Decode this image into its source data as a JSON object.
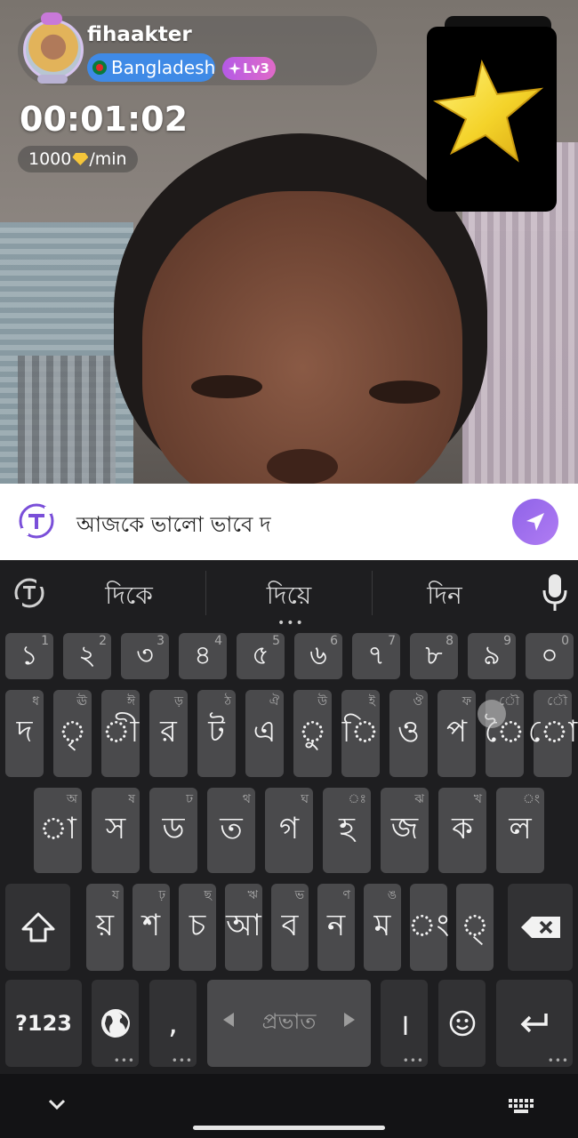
{
  "call": {
    "username": "fihaakter",
    "country": "Bangladesh",
    "level": "Lv3",
    "timer": "00:01:02",
    "rate_amount": "1000",
    "rate_unit": "/min",
    "gem_icon": "gem-icon"
  },
  "message": {
    "text": "আজকে ভালো ভাবে দ",
    "send_icon": "send-icon"
  },
  "keyboard": {
    "suggestions": [
      "দিকে",
      "দিয়ে",
      "দিন"
    ],
    "number_row": [
      "১",
      "২",
      "৩",
      "৪",
      "৫",
      "৬",
      "৭",
      "৮",
      "৯",
      "০"
    ],
    "number_hints": [
      "1",
      "2",
      "3",
      "4",
      "5",
      "6",
      "7",
      "8",
      "9",
      "0"
    ],
    "row1": [
      "দ",
      "ৃ",
      "ী",
      "র",
      "ট",
      "এ",
      "ু",
      "ি",
      "ও",
      "প",
      "ৈ",
      "ো"
    ],
    "row1_hints": [
      "ধ",
      "ঊ",
      "ঈ",
      "ড়",
      "ঠ",
      "ঐ",
      "উ",
      "ই",
      "ঔ",
      "ফ",
      "ৌ",
      "ৌ"
    ],
    "row2": [
      "া",
      "স",
      "ড",
      "ত",
      "গ",
      "হ",
      "জ",
      "ক",
      "ল"
    ],
    "row2_hints": [
      "অ",
      "ষ",
      "ঢ",
      "থ",
      "ঘ",
      "ঃ",
      "ঝ",
      "খ",
      "ং"
    ],
    "row3": [
      "য়",
      "শ",
      "চ",
      "আ",
      "ব",
      "ন",
      "ম",
      "ং",
      "্"
    ],
    "row3_hints": [
      "য",
      "ঢ়",
      "ছ",
      "ঋ",
      "ভ",
      "ণ",
      "ঙ",
      "",
      ""
    ],
    "mode_key": "?123",
    "comma_key": ",",
    "space_label": "প্রভাত",
    "period_key": "।"
  }
}
